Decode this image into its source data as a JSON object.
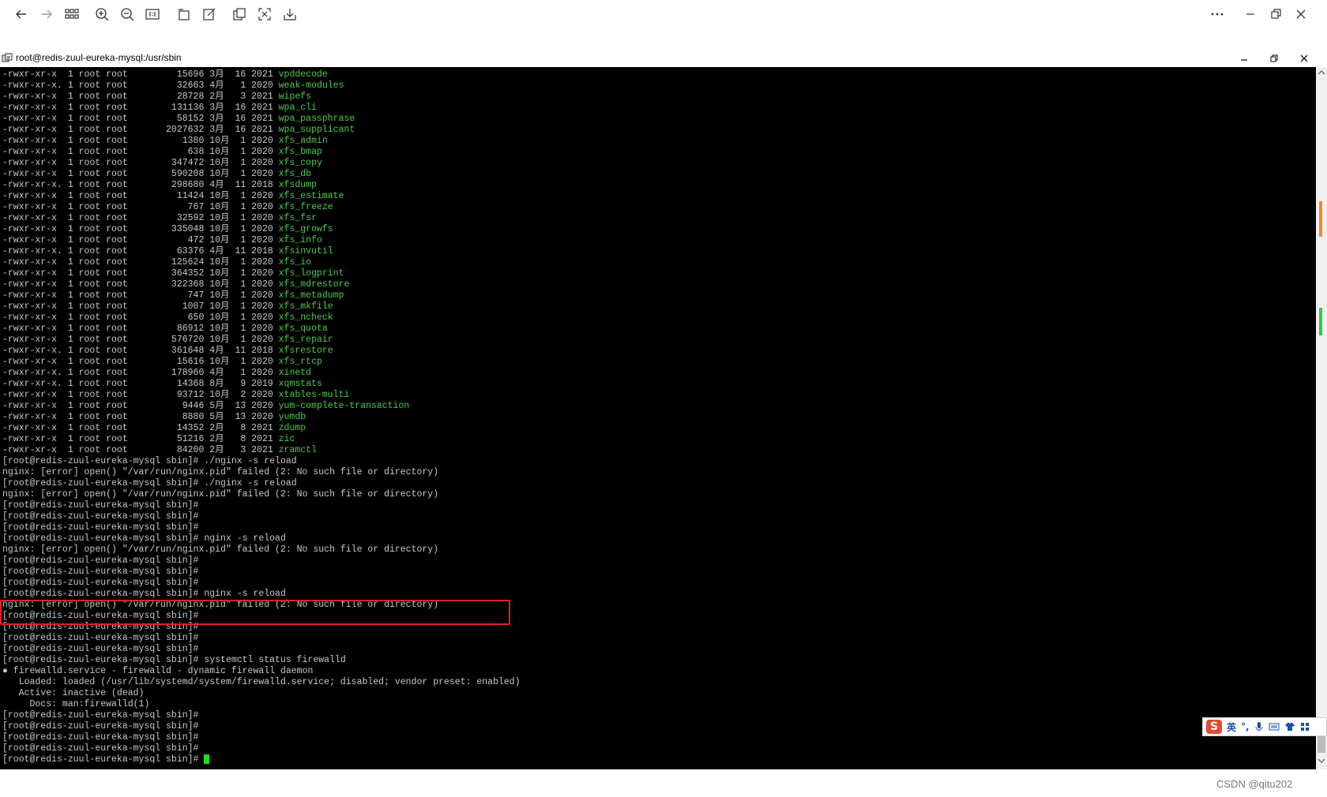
{
  "viewer": {
    "toolbar_icons": [
      "back-arrow-icon",
      "forward-arrow-icon",
      "grid-icon",
      "zoom-in-icon",
      "zoom-out-icon",
      "actual-size-icon",
      "rotate-icon",
      "edit-icon",
      "copy-icon",
      "fullscreen-icon",
      "save-icon"
    ],
    "window_controls": [
      "more-icon",
      "minimize-icon",
      "restore-icon",
      "close-icon"
    ]
  },
  "terminal": {
    "title": "root@redis-zuul-eureka-mysql:/usr/sbin",
    "listing": [
      {
        "perm": "-rwxr-xr-x ",
        "links": "1",
        "user": "root",
        "group": "root",
        "size": "15696",
        "month": "3月",
        "day": "16",
        "year": "2021",
        "name": "vpddecode"
      },
      {
        "perm": "-rwxr-xr-x.",
        "links": "1",
        "user": "root",
        "group": "root",
        "size": "32663",
        "month": "4月",
        "day": "1",
        "year": "2020",
        "name": "weak-modules"
      },
      {
        "perm": "-rwxr-xr-x ",
        "links": "1",
        "user": "root",
        "group": "root",
        "size": "28728",
        "month": "2月",
        "day": "3",
        "year": "2021",
        "name": "wipefs"
      },
      {
        "perm": "-rwxr-xr-x ",
        "links": "1",
        "user": "root",
        "group": "root",
        "size": "131136",
        "month": "3月",
        "day": "16",
        "year": "2021",
        "name": "wpa_cli"
      },
      {
        "perm": "-rwxr-xr-x ",
        "links": "1",
        "user": "root",
        "group": "root",
        "size": "58152",
        "month": "3月",
        "day": "16",
        "year": "2021",
        "name": "wpa_passphrase"
      },
      {
        "perm": "-rwxr-xr-x ",
        "links": "1",
        "user": "root",
        "group": "root",
        "size": "2027632",
        "month": "3月",
        "day": "16",
        "year": "2021",
        "name": "wpa_supplicant"
      },
      {
        "perm": "-rwxr-xr-x ",
        "links": "1",
        "user": "root",
        "group": "root",
        "size": "1380",
        "month": "10月",
        "day": "1",
        "year": "2020",
        "name": "xfs_admin"
      },
      {
        "perm": "-rwxr-xr-x ",
        "links": "1",
        "user": "root",
        "group": "root",
        "size": "638",
        "month": "10月",
        "day": "1",
        "year": "2020",
        "name": "xfs_bmap"
      },
      {
        "perm": "-rwxr-xr-x ",
        "links": "1",
        "user": "root",
        "group": "root",
        "size": "347472",
        "month": "10月",
        "day": "1",
        "year": "2020",
        "name": "xfs_copy"
      },
      {
        "perm": "-rwxr-xr-x ",
        "links": "1",
        "user": "root",
        "group": "root",
        "size": "590208",
        "month": "10月",
        "day": "1",
        "year": "2020",
        "name": "xfs_db"
      },
      {
        "perm": "-rwxr-xr-x.",
        "links": "1",
        "user": "root",
        "group": "root",
        "size": "298680",
        "month": "4月",
        "day": "11",
        "year": "2018",
        "name": "xfsdump"
      },
      {
        "perm": "-rwxr-xr-x ",
        "links": "1",
        "user": "root",
        "group": "root",
        "size": "11424",
        "month": "10月",
        "day": "1",
        "year": "2020",
        "name": "xfs_estimate"
      },
      {
        "perm": "-rwxr-xr-x ",
        "links": "1",
        "user": "root",
        "group": "root",
        "size": "767",
        "month": "10月",
        "day": "1",
        "year": "2020",
        "name": "xfs_freeze"
      },
      {
        "perm": "-rwxr-xr-x ",
        "links": "1",
        "user": "root",
        "group": "root",
        "size": "32592",
        "month": "10月",
        "day": "1",
        "year": "2020",
        "name": "xfs_fsr"
      },
      {
        "perm": "-rwxr-xr-x ",
        "links": "1",
        "user": "root",
        "group": "root",
        "size": "335048",
        "month": "10月",
        "day": "1",
        "year": "2020",
        "name": "xfs_growfs"
      },
      {
        "perm": "-rwxr-xr-x ",
        "links": "1",
        "user": "root",
        "group": "root",
        "size": "472",
        "month": "10月",
        "day": "1",
        "year": "2020",
        "name": "xfs_info"
      },
      {
        "perm": "-rwxr-xr-x.",
        "links": "1",
        "user": "root",
        "group": "root",
        "size": "63376",
        "month": "4月",
        "day": "11",
        "year": "2018",
        "name": "xfsinvutil"
      },
      {
        "perm": "-rwxr-xr-x ",
        "links": "1",
        "user": "root",
        "group": "root",
        "size": "125624",
        "month": "10月",
        "day": "1",
        "year": "2020",
        "name": "xfs_io"
      },
      {
        "perm": "-rwxr-xr-x ",
        "links": "1",
        "user": "root",
        "group": "root",
        "size": "364352",
        "month": "10月",
        "day": "1",
        "year": "2020",
        "name": "xfs_logprint"
      },
      {
        "perm": "-rwxr-xr-x ",
        "links": "1",
        "user": "root",
        "group": "root",
        "size": "322368",
        "month": "10月",
        "day": "1",
        "year": "2020",
        "name": "xfs_mdrestore"
      },
      {
        "perm": "-rwxr-xr-x ",
        "links": "1",
        "user": "root",
        "group": "root",
        "size": "747",
        "month": "10月",
        "day": "1",
        "year": "2020",
        "name": "xfs_metadump"
      },
      {
        "perm": "-rwxr-xr-x ",
        "links": "1",
        "user": "root",
        "group": "root",
        "size": "1007",
        "month": "10月",
        "day": "1",
        "year": "2020",
        "name": "xfs_mkfile"
      },
      {
        "perm": "-rwxr-xr-x ",
        "links": "1",
        "user": "root",
        "group": "root",
        "size": "650",
        "month": "10月",
        "day": "1",
        "year": "2020",
        "name": "xfs_ncheck"
      },
      {
        "perm": "-rwxr-xr-x ",
        "links": "1",
        "user": "root",
        "group": "root",
        "size": "86912",
        "month": "10月",
        "day": "1",
        "year": "2020",
        "name": "xfs_quota"
      },
      {
        "perm": "-rwxr-xr-x ",
        "links": "1",
        "user": "root",
        "group": "root",
        "size": "576720",
        "month": "10月",
        "day": "1",
        "year": "2020",
        "name": "xfs_repair"
      },
      {
        "perm": "-rwxr-xr-x.",
        "links": "1",
        "user": "root",
        "group": "root",
        "size": "361648",
        "month": "4月",
        "day": "11",
        "year": "2018",
        "name": "xfsrestore"
      },
      {
        "perm": "-rwxr-xr-x ",
        "links": "1",
        "user": "root",
        "group": "root",
        "size": "15616",
        "month": "10月",
        "day": "1",
        "year": "2020",
        "name": "xfs_rtcp"
      },
      {
        "perm": "-rwxr-xr-x.",
        "links": "1",
        "user": "root",
        "group": "root",
        "size": "178960",
        "month": "4月",
        "day": "1",
        "year": "2020",
        "name": "xinetd"
      },
      {
        "perm": "-rwxr-xr-x.",
        "links": "1",
        "user": "root",
        "group": "root",
        "size": "14368",
        "month": "8月",
        "day": "9",
        "year": "2019",
        "name": "xqmstats"
      },
      {
        "perm": "-rwxr-xr-x ",
        "links": "1",
        "user": "root",
        "group": "root",
        "size": "93712",
        "month": "10月",
        "day": "2",
        "year": "2020",
        "name": "xtables-multi"
      },
      {
        "perm": "-rwxr-xr-x ",
        "links": "1",
        "user": "root",
        "group": "root",
        "size": "9446",
        "month": "5月",
        "day": "13",
        "year": "2020",
        "name": "yum-complete-transaction"
      },
      {
        "perm": "-rwxr-xr-x ",
        "links": "1",
        "user": "root",
        "group": "root",
        "size": "8880",
        "month": "5月",
        "day": "13",
        "year": "2020",
        "name": "yumdb"
      },
      {
        "perm": "-rwxr-xr-x ",
        "links": "1",
        "user": "root",
        "group": "root",
        "size": "14352",
        "month": "2月",
        "day": "8",
        "year": "2021",
        "name": "zdump"
      },
      {
        "perm": "-rwxr-xr-x ",
        "links": "1",
        "user": "root",
        "group": "root",
        "size": "51216",
        "month": "2月",
        "day": "8",
        "year": "2021",
        "name": "zic"
      },
      {
        "perm": "-rwxr-xr-x ",
        "links": "1",
        "user": "root",
        "group": "root",
        "size": "84200",
        "month": "2月",
        "day": "3",
        "year": "2021",
        "name": "zramctl"
      }
    ],
    "prompt": "[root@redis-zuul-eureka-mysql sbin]#",
    "session": [
      {
        "prompt": true,
        "text": " ./nginx -s reload"
      },
      {
        "prompt": false,
        "text": "nginx: [error] open() \"/var/run/nginx.pid\" failed (2: No such file or directory)"
      },
      {
        "prompt": true,
        "text": " ./nginx -s reload"
      },
      {
        "prompt": false,
        "text": "nginx: [error] open() \"/var/run/nginx.pid\" failed (2: No such file or directory)"
      },
      {
        "prompt": true,
        "text": ""
      },
      {
        "prompt": true,
        "text": ""
      },
      {
        "prompt": true,
        "text": ""
      },
      {
        "prompt": true,
        "text": " nginx -s reload"
      },
      {
        "prompt": false,
        "text": "nginx: [error] open() \"/var/run/nginx.pid\" failed (2: No such file or directory)"
      },
      {
        "prompt": true,
        "text": ""
      },
      {
        "prompt": true,
        "text": ""
      },
      {
        "prompt": true,
        "text": ""
      },
      {
        "prompt": true,
        "text": " nginx -s reload"
      },
      {
        "prompt": false,
        "text": "nginx: [error] open() \"/var/run/nginx.pid\" failed (2: No such file or directory)"
      },
      {
        "prompt": true,
        "text": ""
      },
      {
        "prompt": true,
        "text": ""
      },
      {
        "prompt": true,
        "text": ""
      },
      {
        "prompt": true,
        "text": ""
      },
      {
        "prompt": true,
        "text": " systemctl status firewalld"
      },
      {
        "prompt": false,
        "text": "● firewalld.service - firewalld - dynamic firewall daemon"
      },
      {
        "prompt": false,
        "text": "   Loaded: loaded (/usr/lib/systemd/system/firewalld.service; disabled; vendor preset: enabled)"
      },
      {
        "prompt": false,
        "text": "   Active: inactive (dead)"
      },
      {
        "prompt": false,
        "text": "     Docs: man:firewalld(1)"
      },
      {
        "prompt": true,
        "text": ""
      },
      {
        "prompt": true,
        "text": ""
      },
      {
        "prompt": true,
        "text": ""
      },
      {
        "prompt": true,
        "text": ""
      },
      {
        "prompt": true,
        "text": "",
        "cursor": true
      }
    ],
    "highlight_session_rows": [
      7,
      8
    ]
  },
  "ime": {
    "logo": "S",
    "lang": "英",
    "punct": "°,",
    "icons": [
      "mic-icon",
      "keyboard-icon",
      "shirt-icon",
      "grid-icon"
    ]
  },
  "watermark": "CSDN @qitu202"
}
